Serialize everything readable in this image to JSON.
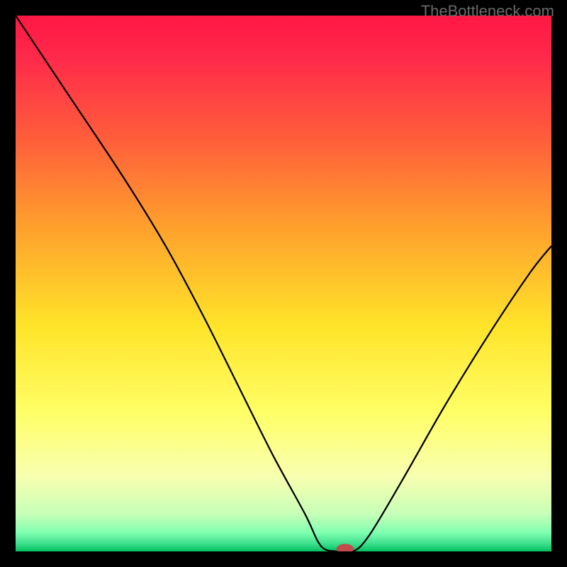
{
  "watermark": "TheBottleneck.com",
  "chart_data": {
    "type": "line",
    "title": "",
    "xlabel": "",
    "ylabel": "",
    "xlim": [
      0,
      100
    ],
    "ylim": [
      0,
      100
    ],
    "background_gradient": {
      "stops": [
        {
          "pos": 0.0,
          "color": "#ff1744"
        },
        {
          "pos": 0.08,
          "color": "#ff2a4a"
        },
        {
          "pos": 0.22,
          "color": "#ff5a3c"
        },
        {
          "pos": 0.4,
          "color": "#ffa22c"
        },
        {
          "pos": 0.58,
          "color": "#ffe42a"
        },
        {
          "pos": 0.74,
          "color": "#ffff66"
        },
        {
          "pos": 0.86,
          "color": "#f8ffb0"
        },
        {
          "pos": 0.93,
          "color": "#c8ffb8"
        },
        {
          "pos": 0.965,
          "color": "#80ffb0"
        },
        {
          "pos": 0.985,
          "color": "#40e090"
        },
        {
          "pos": 1.0,
          "color": "#00c060"
        }
      ]
    },
    "series": [
      {
        "name": "bottleneck-curve",
        "type": "curve",
        "stroke": "#000000",
        "stroke_width": 2.2,
        "points": [
          {
            "x": 0,
            "y": 100
          },
          {
            "x": 10,
            "y": 85
          },
          {
            "x": 20,
            "y": 70
          },
          {
            "x": 28,
            "y": 57
          },
          {
            "x": 35,
            "y": 44
          },
          {
            "x": 42,
            "y": 30
          },
          {
            "x": 48,
            "y": 18
          },
          {
            "x": 54,
            "y": 7
          },
          {
            "x": 57,
            "y": 1
          },
          {
            "x": 60,
            "y": 0
          },
          {
            "x": 63,
            "y": 0
          },
          {
            "x": 66,
            "y": 3
          },
          {
            "x": 72,
            "y": 13
          },
          {
            "x": 80,
            "y": 27
          },
          {
            "x": 88,
            "y": 40
          },
          {
            "x": 96,
            "y": 52
          },
          {
            "x": 100,
            "y": 57
          }
        ]
      }
    ],
    "marker": {
      "name": "optimal-point",
      "x": 61.5,
      "y": 0,
      "rx": 1.6,
      "ry": 0.9,
      "fill": "#c24b4b"
    }
  }
}
